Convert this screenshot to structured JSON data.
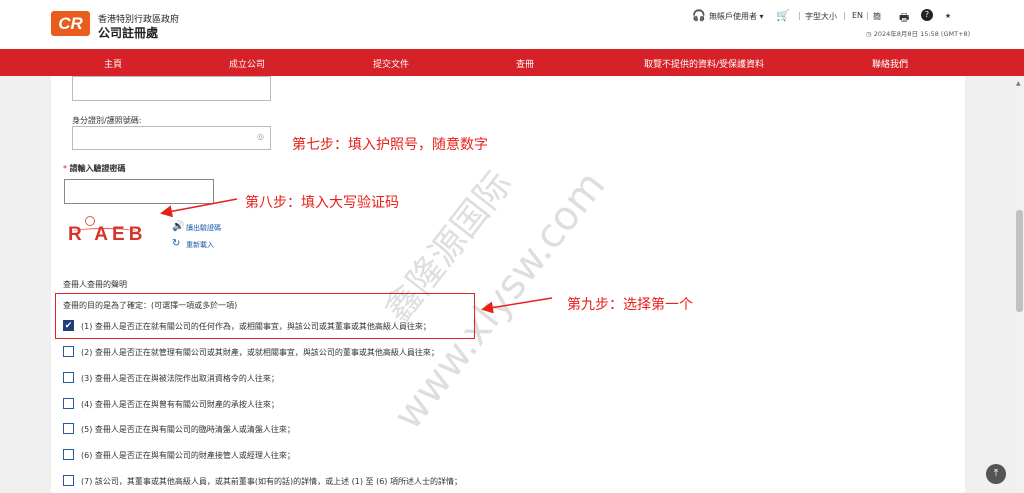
{
  "header": {
    "logo_mark": "CR",
    "gov_name": "香港特別行政區政府",
    "registry_name": "公司註冊處",
    "account_label": "無帳戶使用者 ▾",
    "font_size_label": "字型大小",
    "lang_en": "EN",
    "lang_sep1": "|",
    "lang_sep2": "|",
    "lang_sc": "簡",
    "datetime": "2024年8月8日 15:58 (GMT+8)"
  },
  "nav": {
    "items": [
      "主頁",
      "成立公司",
      "提交文件",
      "查冊",
      "取覽不提供的資料/受保護資料",
      "聯絡我們"
    ]
  },
  "form": {
    "id_label": "身分證別/護照號碼:",
    "captcha_required": "*",
    "captcha_label": "請輸入驗證密碼",
    "captcha_text": "R AEB",
    "read_captcha": "讀出驗證碼",
    "refresh": "重新載入",
    "declaration_title": "查冊人查冊的聲明",
    "purpose_label": "查冊的目的是為了確定：(可選擇一項或多於一項)",
    "options": [
      {
        "text": "(1) 查冊人是否正在就有關公司的任何作為，或相關事宜，與該公司或其董事或其他高級人員往來；",
        "checked": true
      },
      {
        "text": "(2) 查冊人是否正在就管理有關公司或其財產，或就相關事宜，與該公司的董事或其他高級人員往來；",
        "checked": false
      },
      {
        "text": "(3) 查冊人是否正在與被法院作出取消資格令的人往來；",
        "checked": false
      },
      {
        "text": "(4) 查冊人是否正在與曾有有關公司財產的承按人往來；",
        "checked": false
      },
      {
        "text": "(5) 查冊人是否正在與有關公司的臨時清盤人或清盤人往來；",
        "checked": false
      },
      {
        "text": "(6) 查冊人是否正在與有關公司的財產接管人或經理人往來；",
        "checked": false
      },
      {
        "text": "(7) 該公司，其董事或其他高級人員，或其前董事(如有的話)的詳情，或上述 (1) 至 (6) 項所述人士的詳情；",
        "checked": false
      }
    ]
  },
  "annotations": {
    "step7": "第七步：填入护照号，随意数字",
    "step8": "第八步：填入大写验证码",
    "step9": "第九步：选择第一个"
  },
  "watermark": {
    "line1": "鑫隆源国际",
    "line2": "www.xlysw.com"
  },
  "colors": {
    "brand_orange": "#e85d1c",
    "nav_red": "#d52127",
    "annotation_red": "#e8201a",
    "checkbox_blue": "#1f3f78"
  }
}
